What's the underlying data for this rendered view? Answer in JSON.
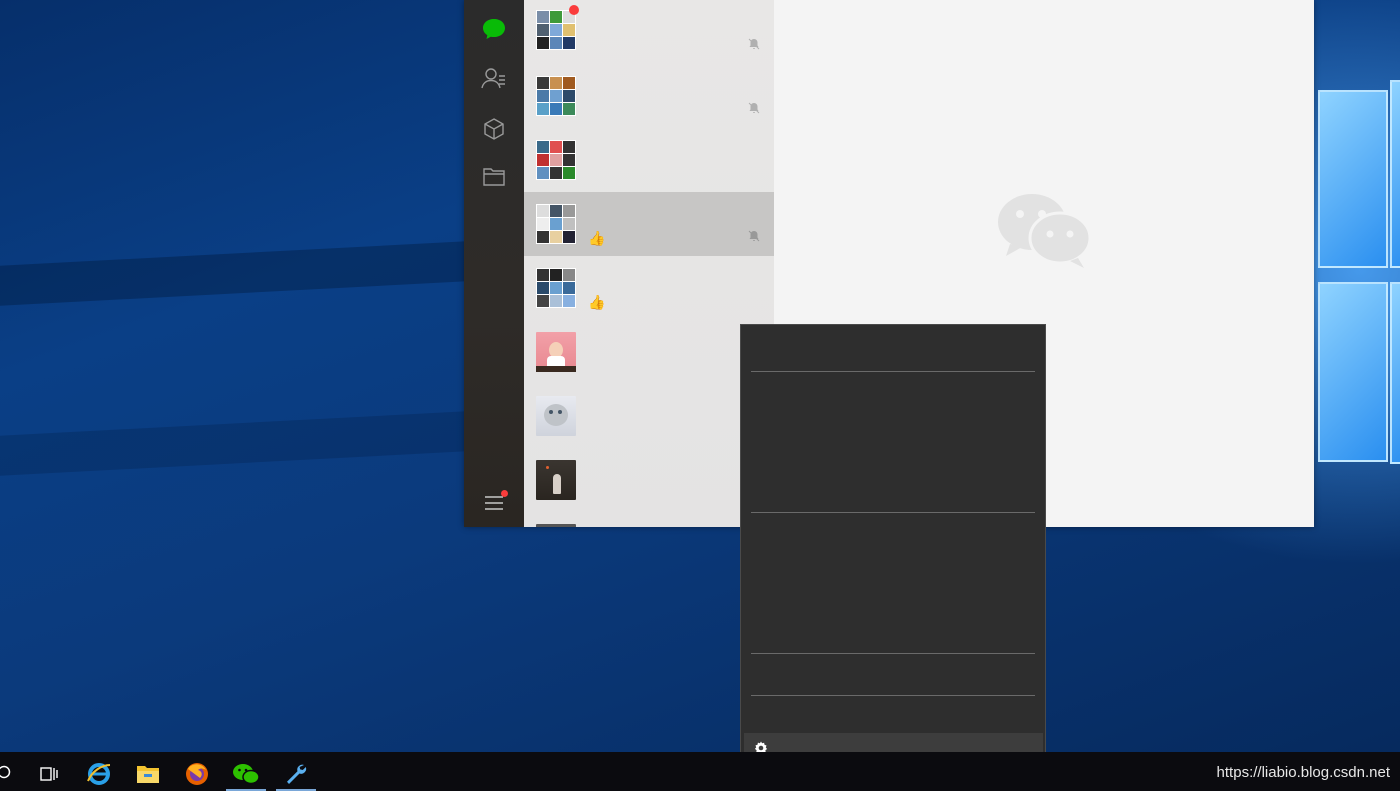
{
  "colors": {
    "wechat_green": "#09bb07",
    "nav_bg": "#2b2b2b",
    "list_bg": "#e6e5e5",
    "selected_bg": "#c7c6c5",
    "chat_bg": "#f4f4f4",
    "menu_bg": "#2e2e2e",
    "badge_red": "#fa3c3c",
    "taskbar_bg": "#0b0b0f"
  },
  "nav": {
    "icons": [
      "chat-bubble-icon",
      "contacts-icon",
      "cube-icon",
      "folder-icon",
      "hamburger-menu-icon"
    ]
  },
  "chatlist": {
    "items": [
      {
        "type": "group",
        "muted": true,
        "badge": true,
        "selected": false
      },
      {
        "type": "group",
        "muted": true,
        "badge": false,
        "selected": false
      },
      {
        "type": "group",
        "muted": false,
        "badge": false,
        "selected": false
      },
      {
        "type": "group",
        "muted": true,
        "badge": false,
        "selected": true,
        "emoji": "👍"
      },
      {
        "type": "group",
        "muted": false,
        "badge": false,
        "selected": false,
        "emoji": "👍"
      },
      {
        "type": "single",
        "muted": false,
        "selected": false
      },
      {
        "type": "single",
        "muted": false,
        "selected": false
      },
      {
        "type": "single",
        "muted": false,
        "selected": false
      }
    ]
  },
  "menu": {
    "settings_icon": "gear-icon"
  },
  "taskbar": {
    "apps": [
      "search-icon",
      "task-view-icon",
      "internet-explorer-icon",
      "file-explorer-icon",
      "firefox-icon",
      "wechat-icon",
      "tool-wrench-icon"
    ],
    "watermark": "https://liabio.blog.csdn.net"
  }
}
